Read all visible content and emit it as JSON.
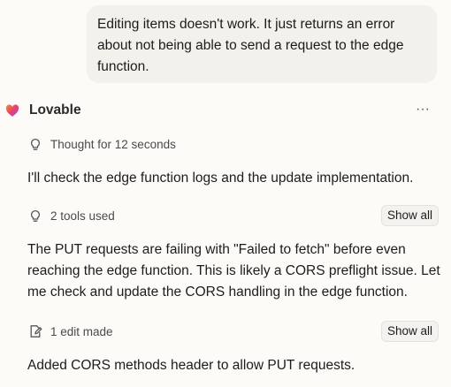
{
  "user_message": {
    "text": "Editing items doesn't work. It just returns an error about not being able to send a request to the edge function."
  },
  "assistant": {
    "name": "Lovable",
    "more_label": "···",
    "thought": {
      "icon": "lightbulb-icon",
      "label": "Thought for 12 seconds"
    },
    "intro": "I'll check the edge function logs and the update implementation.",
    "tools": {
      "icon": "lightbulb-icon",
      "label": "2 tools used",
      "button": "Show all"
    },
    "analysis": "The PUT requests are failing with \"Failed to fetch\" before even reaching the edge function. This is likely a CORS preflight issue. Let me check and update the CORS handling in the edge function.",
    "edits": {
      "icon": "edit-file-icon",
      "label": "1 edit made",
      "button": "Show all"
    },
    "summary": "Added CORS methods header to allow PUT requests."
  },
  "colors": {
    "background": "#fcfbf8",
    "user_bubble": "#f3f1ec",
    "button_bg": "#f4f2ee",
    "logo_gradient": [
      "#f3902b",
      "#ea3f6b",
      "#8b5cf6"
    ]
  }
}
